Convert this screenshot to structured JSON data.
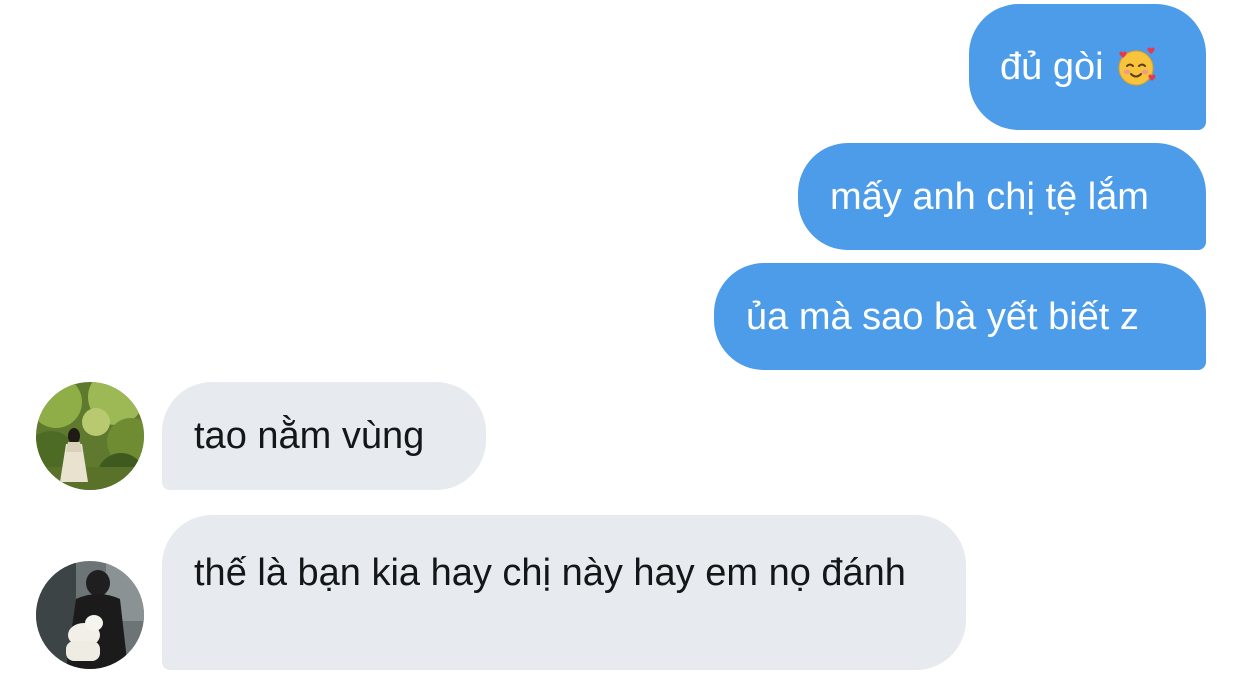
{
  "messages": {
    "sent": [
      {
        "text": "đủ gòi",
        "emoji": "smiling-face-with-hearts-icon"
      },
      {
        "text": "mấy anh chị tệ lắm"
      },
      {
        "text": "ủa mà sao bà yết biết z"
      }
    ],
    "received": [
      {
        "text": "tao nằm vùng",
        "avatar": "avatar-girl-in-forest"
      },
      {
        "text": "thế là bạn kia hay chị này hay em nọ đánh",
        "avatar": "avatar-boy-with-dog"
      }
    ]
  },
  "colors": {
    "sent_bubble": "#4c9ce9",
    "received_bubble": "#e7eaee",
    "background": "#ffffff"
  }
}
